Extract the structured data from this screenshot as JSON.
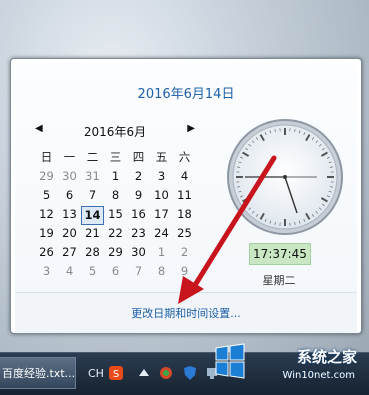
{
  "popup": {
    "date_title": "2016年6月14日",
    "nav": {
      "prev": "◀",
      "next": "▶",
      "month": "2016年6月"
    },
    "weekdays": [
      "日",
      "一",
      "二",
      "三",
      "四",
      "五",
      "六"
    ],
    "weeks": [
      [
        {
          "d": "29",
          "dim": true
        },
        {
          "d": "30",
          "dim": true
        },
        {
          "d": "31",
          "dim": true
        },
        {
          "d": "1"
        },
        {
          "d": "2"
        },
        {
          "d": "3"
        },
        {
          "d": "4"
        }
      ],
      [
        {
          "d": "5"
        },
        {
          "d": "6"
        },
        {
          "d": "7"
        },
        {
          "d": "8"
        },
        {
          "d": "9"
        },
        {
          "d": "10"
        },
        {
          "d": "11"
        }
      ],
      [
        {
          "d": "12"
        },
        {
          "d": "13"
        },
        {
          "d": "14",
          "today": true
        },
        {
          "d": "15"
        },
        {
          "d": "16"
        },
        {
          "d": "17"
        },
        {
          "d": "18"
        }
      ],
      [
        {
          "d": "19"
        },
        {
          "d": "20"
        },
        {
          "d": "21"
        },
        {
          "d": "22"
        },
        {
          "d": "23"
        },
        {
          "d": "24"
        },
        {
          "d": "25"
        }
      ],
      [
        {
          "d": "26"
        },
        {
          "d": "27"
        },
        {
          "d": "28"
        },
        {
          "d": "29"
        },
        {
          "d": "30"
        },
        {
          "d": "1",
          "dim": true
        },
        {
          "d": "2",
          "dim": true
        }
      ],
      [
        {
          "d": "3",
          "dim": true
        },
        {
          "d": "4",
          "dim": true
        },
        {
          "d": "5",
          "dim": true
        },
        {
          "d": "6",
          "dim": true
        },
        {
          "d": "7",
          "dim": true
        },
        {
          "d": "8",
          "dim": true
        },
        {
          "d": "9",
          "dim": true
        }
      ]
    ],
    "clock_time": "17:37:45",
    "weekday": "星期二",
    "change_link": "更改日期和时间设置..."
  },
  "taskbar": {
    "task_label": "百度经验.txt...",
    "lang": "CH",
    "tray_icons": [
      "sogou-input-icon",
      "arrow-up-icon",
      "game-icon",
      "shield-icon",
      "network-icon"
    ]
  },
  "watermark": {
    "line1": "系统之家",
    "line2": "Win10net.com"
  },
  "colors": {
    "accent": "#1e5fa8",
    "arrow": "#c8141c",
    "time_bg": "#c9e7c2"
  }
}
